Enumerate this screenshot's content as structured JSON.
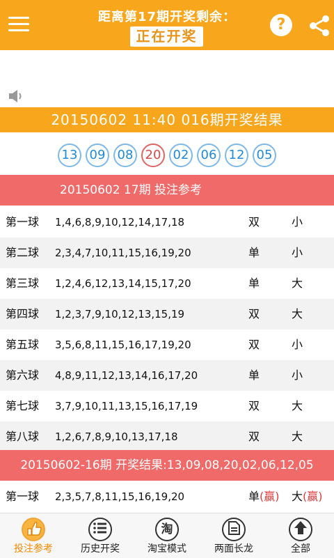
{
  "header": {
    "countdown_label": "距离第17期开奖剩余：",
    "status": "正在开奖",
    "icons": [
      "menu-icon",
      "help-icon",
      "share-icon"
    ]
  },
  "latest_result": {
    "title": "20150602  11:40  016期开奖结果",
    "balls": [
      "13",
      "09",
      "08",
      "20",
      "02",
      "06",
      "12",
      "05"
    ],
    "highlight_index": 3
  },
  "reference": {
    "title": "20150602   17期  投注参考",
    "rows": [
      {
        "label": "第一球",
        "nums": "1,4,6,8,9,10,12,14,17,18",
        "oe": "双",
        "size": "小"
      },
      {
        "label": "第二球",
        "nums": "2,3,4,7,10,11,15,16,19,20",
        "oe": "单",
        "size": "小"
      },
      {
        "label": "第三球",
        "nums": "1,2,4,6,12,13,14,15,17,20",
        "oe": "单",
        "size": "大"
      },
      {
        "label": "第四球",
        "nums": "1,2,3,7,9,10,12,13,15,19",
        "oe": "双",
        "size": "大"
      },
      {
        "label": "第五球",
        "nums": "3,5,6,8,11,15,16,17,19,20",
        "oe": "双",
        "size": "小"
      },
      {
        "label": "第六球",
        "nums": "4,8,9,11,12,13,14,16,17,20",
        "oe": "单",
        "size": "小"
      },
      {
        "label": "第七球",
        "nums": "3,7,9,10,11,13,15,16,17,19",
        "oe": "双",
        "size": "大"
      },
      {
        "label": "第八球",
        "nums": "1,2,6,7,8,9,10,13,17,18",
        "oe": "双",
        "size": "大"
      }
    ]
  },
  "previous": {
    "title": "20150602-16期 开奖结果:13,09,08,20,02,06,12,05",
    "rows": [
      {
        "label": "第一球",
        "nums": "2,3,5,7,8,11,15,16,19,20",
        "oe": "单",
        "oe_mark": "(赢)",
        "size": "大",
        "size_mark": "(赢)"
      }
    ]
  },
  "nav": [
    {
      "label": "投注参考",
      "icon": "thumbs-up-icon",
      "active": true
    },
    {
      "label": "历史开奖",
      "icon": "list-icon",
      "active": false
    },
    {
      "label": "淘宝模式",
      "icon": "taobao-icon",
      "glyph": "淘",
      "active": false
    },
    {
      "label": "两面长龙",
      "icon": "document-icon",
      "active": false
    },
    {
      "label": "全部",
      "icon": "up-arrow-icon",
      "active": false
    }
  ],
  "colors": {
    "accent": "#f8a61b",
    "section_red": "#f06a6a",
    "ball_blue": "#1e8ad9",
    "ball_red": "#d94848",
    "win_red": "#e03c3c"
  }
}
